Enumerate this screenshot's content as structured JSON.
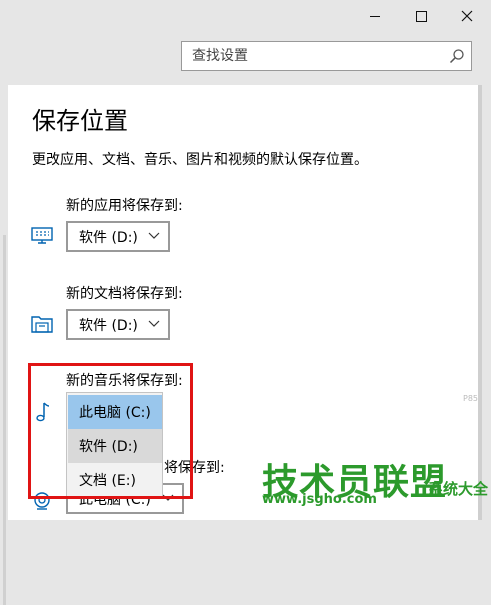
{
  "search": {
    "placeholder": "查找设置",
    "icon": "search-icon"
  },
  "page": {
    "title": "保存位置",
    "description": "更改应用、文档、音乐、图片和视频的默认保存位置。"
  },
  "sections": {
    "apps": {
      "label": "新的应用将保存到:",
      "value": "软件 (D:)",
      "icon": "monitor-icon"
    },
    "docs": {
      "label": "新的文档将保存到:",
      "value": "软件 (D:)",
      "icon": "folder-icon"
    },
    "music": {
      "label": "新的音乐将保存到:",
      "icon": "music-note-icon"
    },
    "pictures": {
      "label_tail": "将保存到:",
      "value": "此电脑 (C:)",
      "icon": "camera-icon"
    }
  },
  "music_dropdown_options": [
    "此电脑 (C:)",
    "软件 (D:)",
    "文档 (E:)"
  ],
  "music_selected_option": "此电脑 (C:)",
  "watermark": {
    "main": "技术员联盟",
    "url": "www.jsgho.com",
    "extra": "系统大全",
    "small": "P85.COM"
  },
  "colors": {
    "accent": "#0063b1",
    "highlight": "#e01414",
    "selected": "#99c6ec",
    "watermark": "#2c9a2c"
  }
}
